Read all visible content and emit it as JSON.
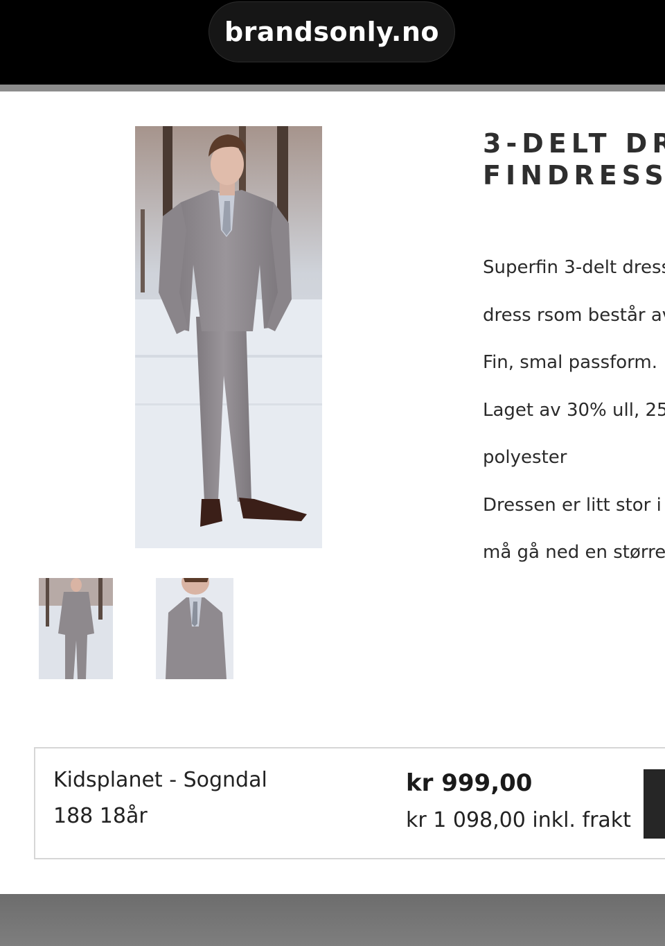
{
  "browser": {
    "url": "brandsonly.no"
  },
  "product": {
    "title_line1": "3-DELT DR",
    "title_line2": "FINDRESS",
    "description_lines": [
      "Superfin 3-delt dress",
      "dress rsom består av",
      "Fin, smal passform. .",
      "Laget av 30% ull, 25",
      "polyester",
      "Dressen er litt stor i .",
      "må gå ned en større"
    ],
    "image_alt": "Gutt i grå 3-delt dress",
    "thumbnail_alts": [
      "Dress helfigur",
      "Dress nærbilde"
    ]
  },
  "offer": {
    "store": "Kidsplanet - Sogndal",
    "size": "188 18år",
    "price": "kr 999,00",
    "price_with_shipping": "kr 1 098,00 inkl. frakt"
  },
  "colors": {
    "suit_gray": "#8f8a8e",
    "button_dark": "#262626"
  }
}
